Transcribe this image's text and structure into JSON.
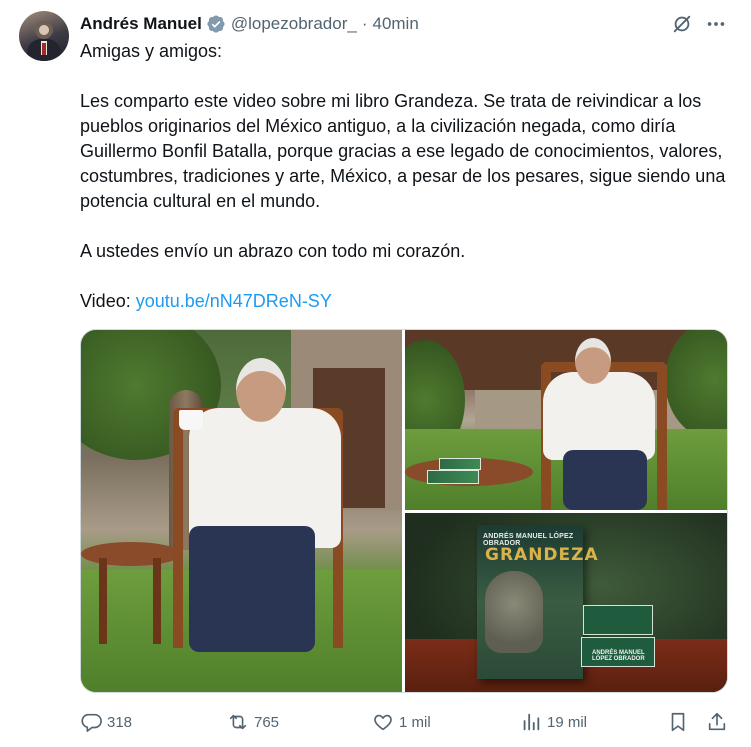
{
  "author": {
    "name": "Andrés Manuel",
    "handle": "@lopezobrador_",
    "separator": "·",
    "time": "40min",
    "verified_color": "#829aab"
  },
  "post": {
    "line1": "Amigas y amigos:",
    "paragraph1": "Les comparto este video sobre mi libro Grandeza. Se trata de reivindicar a los pueblos originarios del México antiguo, a la civilización negada, como diría Guillermo Bonfil Batalla, porque gracias a ese legado de conocimientos, valores, costumbres, tradiciones y arte, México, a pesar de los pesares, sigue siendo una potencia cultural en el mundo.",
    "paragraph2": "A ustedes envío un abrazo con todo mi corazón.",
    "video_label": "Video: ",
    "video_link": "youtu.be/nN47DReN-SY",
    "link_color": "#1d9bf0"
  },
  "media": {
    "images": [
      {
        "icon": "photo-man-with-cup"
      },
      {
        "icon": "photo-man-seated-garden"
      },
      {
        "icon": "photo-book-grandeza"
      }
    ],
    "book_author": "ANDRÉS MANUEL LÓPEZ OBRADOR",
    "book_title": "GRANDEZA",
    "spine_text": "ANDRÉS MANUEL LÓPEZ OBRADOR"
  },
  "actions": {
    "replies": "318",
    "reposts": "765",
    "likes": "1 mil",
    "views": "19 mil",
    "icon_color": "#536471"
  }
}
